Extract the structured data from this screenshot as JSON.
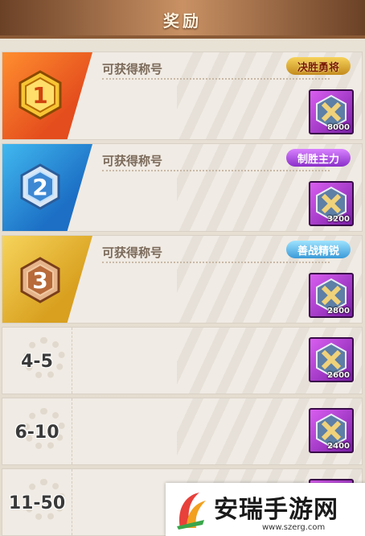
{
  "header": {
    "title": "奖励"
  },
  "rows": [
    {
      "rank": "1",
      "label": "可获得称号",
      "title_badge": "决胜勇将",
      "reward_count": "8000"
    },
    {
      "rank": "2",
      "label": "可获得称号",
      "title_badge": "制胜主力",
      "reward_count": "3200"
    },
    {
      "rank": "3",
      "label": "可获得称号",
      "title_badge": "善战精锐",
      "reward_count": "2800"
    },
    {
      "rank": "4-5",
      "reward_count": "2600"
    },
    {
      "rank": "6-10",
      "reward_count": "2400"
    },
    {
      "rank": "11-50"
    }
  ],
  "watermark": {
    "text": "安瑞手游网",
    "url": "www.szerg.com"
  },
  "colors": {
    "rank1": "#e44d1d",
    "rank2": "#1c6fc5",
    "rank3": "#d9a01f",
    "reward_frame": "#9a34c7"
  }
}
